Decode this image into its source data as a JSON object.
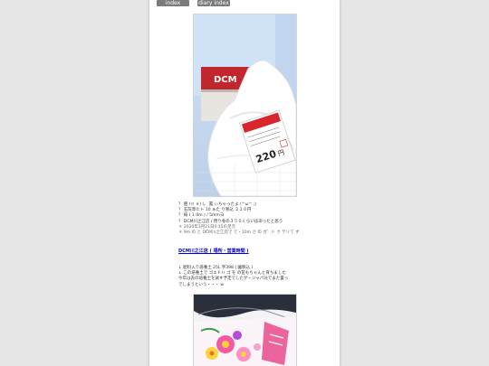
{
  "nav": {
    "index_label": "index",
    "diary_index_label": "diary index"
  },
  "photos": {
    "photo1": {
      "sign_text": "DCM",
      "tag_price": "220",
      "tag_unit": "円"
    },
    "photo2": {}
  },
  "post1": {
    "lines": [
      "？ 肥 (ㅁ ㅎ) l。 置 ぃちゃったよ (^ω^ ;)",
      "？ 石灰草ヒト 10 ぁた り税込 ２２０円",
      "？ 綺 ( 1.0m ) / 5mmヨ",
      "？ DCM川之江店 / 用り冬の３５０くらいはあったと思う",
      "＊ 2020年3月21日0:15の足元",
      "＊ 9m の と DCM川之江店で て・10m さ の ガ゛ド ク テリて ず"
    ]
  },
  "store_link": "DCM川之江店 ( 場所・営業時間 )",
  "post2": {
    "lines": [
      "↓ 肥料入り培養土 25L 字398 ( 園税込 )",
      "↓ この培養土で ゴエドハ ゴ を の苗もちゃんと育ちました",
      "今年は去の培養土を試す予定でしたが・ジャパ分でまた置っ",
      "でしまうという・・・ w"
    ]
  }
}
